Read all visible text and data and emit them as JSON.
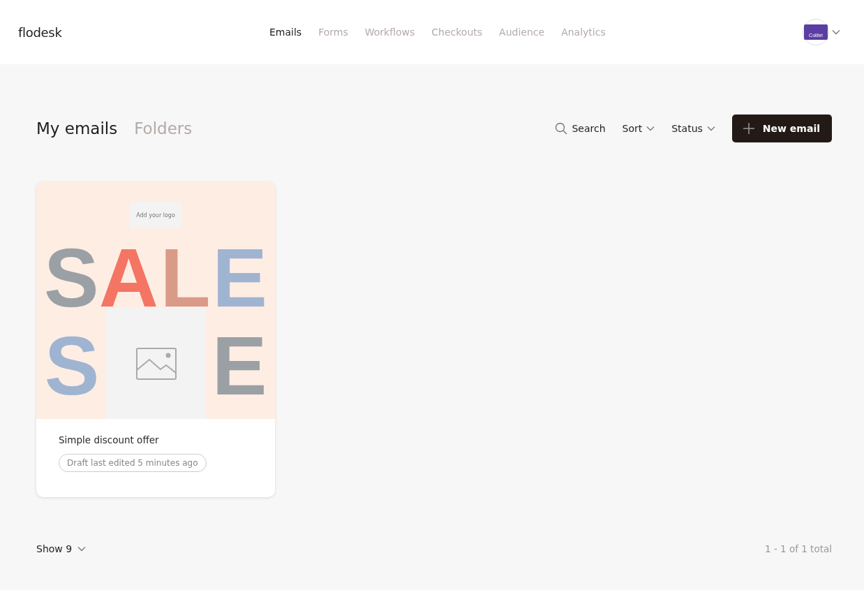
{
  "brand": "flodesk",
  "nav": [
    {
      "label": "Emails",
      "selected": true
    },
    {
      "label": "Forms",
      "selected": false
    },
    {
      "label": "Workflows",
      "selected": false
    },
    {
      "label": "Checkouts",
      "selected": false
    },
    {
      "label": "Audience",
      "selected": false
    },
    {
      "label": "Analytics",
      "selected": false
    }
  ],
  "account": {
    "logo_text": "Colibri"
  },
  "views": [
    {
      "label": "My emails",
      "selected": true
    },
    {
      "label": "Folders",
      "selected": false
    }
  ],
  "toolbar": {
    "search": "Search",
    "sort": "Sort",
    "status": "Status",
    "new_button": "New email"
  },
  "emails": [
    {
      "title": "Simple discount offer",
      "status": "Draft last edited 5 minutes ago",
      "preview": {
        "logo_placeholder": "Add your logo",
        "rows": [
          {
            "letters": [
              {
                "char": "S",
                "color": "#9aa0a4"
              },
              {
                "char": "A",
                "color": "#f47564"
              },
              {
                "char": "L",
                "color": "#d99a88"
              },
              {
                "char": "E",
                "color": "#9fb4d1"
              }
            ]
          },
          {
            "letters": [
              {
                "char": "S",
                "color": "#9fb4d1"
              },
              {
                "char": "E",
                "color": "#9aa0a4"
              }
            ]
          }
        ]
      }
    }
  ],
  "footer": {
    "show": "Show 9",
    "count": "1 - 1 of 1 total"
  }
}
